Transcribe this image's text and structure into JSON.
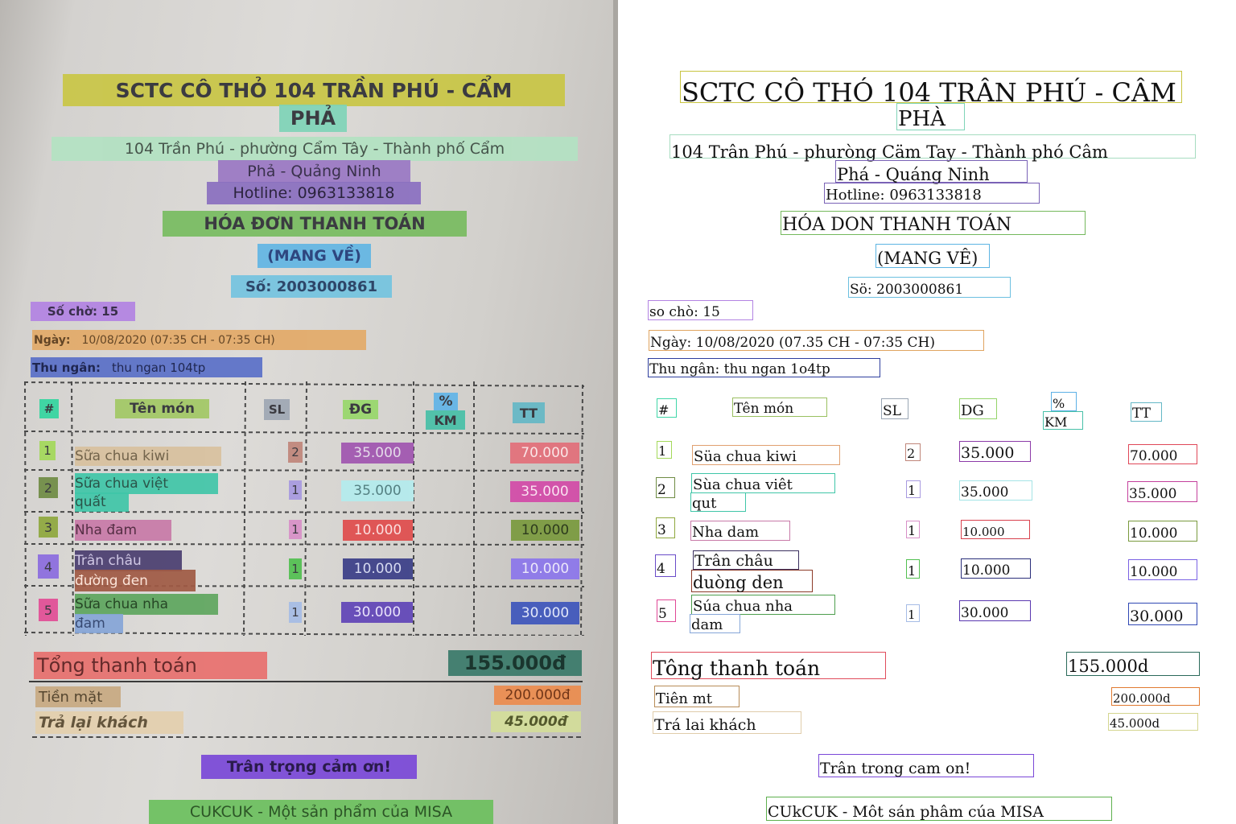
{
  "photo": {
    "store_name_line1": "SCTC CÔ THỎ 104 TRẦN PHÚ - CẨM",
    "store_name_line2": "PHẢ",
    "address_line1": "104 Trần Phú - phường Cẩm Tây - Thành phố Cẩm",
    "address_line2": "Phả - Quảng Ninh",
    "hotline": "Hotline: 0963133818",
    "invoice_title": "HÓA ĐƠN THANH TOÁN",
    "order_type": "(MANG VỀ)",
    "invoice_number": "Số: 2003000861",
    "queue_number": "Số chờ: 15",
    "date_label": "Ngày:",
    "date_value": "10/08/2020 (07:35 CH - 07:35 CH)",
    "cashier_label": "Thu ngân:",
    "cashier_value": "thu ngan 104tp",
    "columns": {
      "index": "#",
      "item": "Tên món",
      "qty": "SL",
      "price": "ĐG",
      "discount_top": "%",
      "discount_bottom": "KM",
      "total": "TT"
    },
    "items": [
      {
        "index": "1",
        "name_line1": "Sữa chua kiwi",
        "name_line2": "",
        "qty": "2",
        "price": "35.000",
        "total": "70.000"
      },
      {
        "index": "2",
        "name_line1": "Sữa chua việt",
        "name_line2": "quất",
        "qty": "1",
        "price": "35.000",
        "total": "35.000"
      },
      {
        "index": "3",
        "name_line1": "Nha đam",
        "name_line2": "",
        "qty": "1",
        "price": "10.000",
        "total": "10.000"
      },
      {
        "index": "4",
        "name_line1": "Trân châu",
        "name_line2": "đường đen",
        "qty": "1",
        "price": "10.000",
        "total": "10.000"
      },
      {
        "index": "5",
        "name_line1": "Sữa chua nha",
        "name_line2": "đam",
        "qty": "1",
        "price": "30.000",
        "total": "30.000"
      }
    ],
    "total_label": "Tổng thanh toán",
    "total_value": "155.000đ",
    "cash_label": "Tiền mặt",
    "cash_value": "200.000đ",
    "change_label": "Trả lại khách",
    "change_value": "45.000đ",
    "thanks": "Trân trọng cảm ơn!",
    "footer": "CUKCUK - Một sản phẩm của MISA"
  },
  "ocr": {
    "store_name_line1": "SCTC CÔ THÓ 104 TRÂN PHÚ - CÂM",
    "store_name_line2": "PHÀ",
    "address_line1": "104 Trân Phú - phuròng Cäm Tay - Thành phó Câm",
    "address_line2": "Phá - Quáng Ninh",
    "hotline": "Hotline: 0963133818",
    "invoice_title": "HÓA DON THANH TOÁN",
    "order_type": "(MANG VÊ)",
    "invoice_number": "Sö: 2003000861",
    "queue_number": "so chò: 15",
    "date": "Ngày: 10/08/2020 (07.35 CH - 07:35 CH)",
    "cashier": "Thu ngân: thu ngan 1o4tp",
    "col_index": "#",
    "col_item": "Tên món",
    "col_qty": "SL",
    "col_price": "DG",
    "col_discount_top": "%",
    "col_discount_bottom": "KM",
    "col_total": "TT",
    "r1_index": "1",
    "r1_name": "Süa chua kiwi",
    "r1_qty": "2",
    "r1_price": "35.000",
    "r1_total": "70.000",
    "r2_index": "2",
    "r2_name1": "Sùa chua viêt",
    "r2_name2": "qut",
    "r2_qty": "1",
    "r2_price": "35.000",
    "r2_total": "35.000",
    "r3_index": "3",
    "r3_name": "Nha dam",
    "r3_qty": "1",
    "r3_price": "10.000",
    "r3_total": "10.000",
    "r4_index": "4",
    "r4_name1": "Trân châu",
    "r4_name2": "duòng den",
    "r4_qty": "1",
    "r4_price": "10.000",
    "r4_total": "10.000",
    "r5_index": "5",
    "r5_name1": "Súa chua nha",
    "r5_name2": "dam",
    "r5_qty": "1",
    "r5_price": "30.000",
    "r5_total": "30.000",
    "total_label": "Tông thanh toán",
    "total_value": "155.000d",
    "cash_label": "Tiên mt",
    "cash_value": "200.000d",
    "change_label": "Trá lai khách",
    "change_value": "45.000d",
    "thanks": "Trân trong cam on!",
    "footer": "CUkCUK - Môt sán phâm cúa MISA"
  }
}
